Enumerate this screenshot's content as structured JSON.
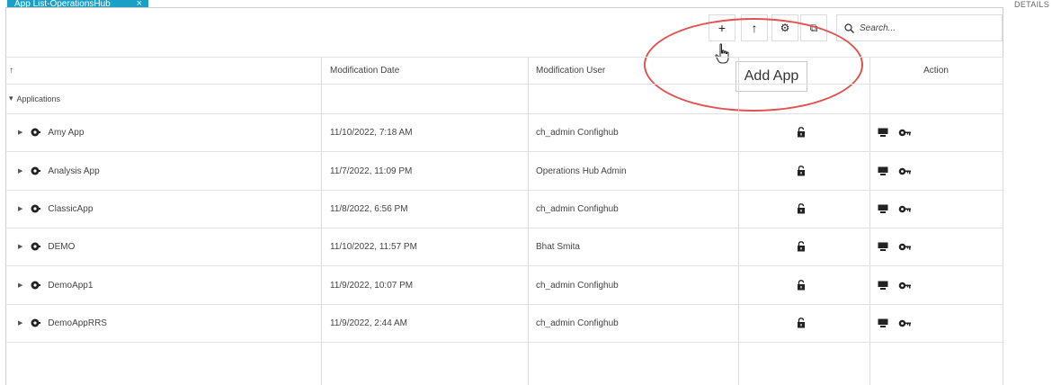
{
  "tab": {
    "label": "App List-OperationsHub",
    "close": "×"
  },
  "details_label": "DETAILS",
  "toolbar": {
    "add_glyph": "+",
    "upload_glyph": "↑",
    "settings_glyph": "⚙",
    "copy_glyph": "⧉",
    "search_placeholder": "Search..."
  },
  "tooltip": "Add App",
  "columns": {
    "sort_indicator": "↑",
    "modification_date": "Modification Date",
    "modification_user": "Modification User",
    "action": "Action"
  },
  "group": {
    "label": "Applications",
    "toggle": "▾"
  },
  "rows": [
    {
      "name": "Amy App",
      "date": "11/10/2022, 7:18 AM",
      "user": "ch_admin Confighub"
    },
    {
      "name": "Analysis App",
      "date": "11/7/2022, 11:09 PM",
      "user": "Operations Hub Admin"
    },
    {
      "name": "ClassicApp",
      "date": "11/8/2022, 6:56 PM",
      "user": "ch_admin Confighub"
    },
    {
      "name": "DEMO",
      "date": "11/10/2022, 11:57 PM",
      "user": "Bhat Smita"
    },
    {
      "name": "DemoApp1",
      "date": "11/9/2022, 10:07 PM",
      "user": "ch_admin Confighub"
    },
    {
      "name": "DemoAppRRS",
      "date": "11/9/2022, 2:44 AM",
      "user": "ch_admin Confighub"
    }
  ],
  "colors": {
    "tab_accent": "#1aa0c7",
    "highlight": "#e0524f"
  },
  "icons": {
    "row_toggle": "caret-right-icon",
    "app": "app-gear-icon",
    "lock": "unlock-icon",
    "deploy": "monitor-icon",
    "permissions": "key-gear-icon"
  }
}
